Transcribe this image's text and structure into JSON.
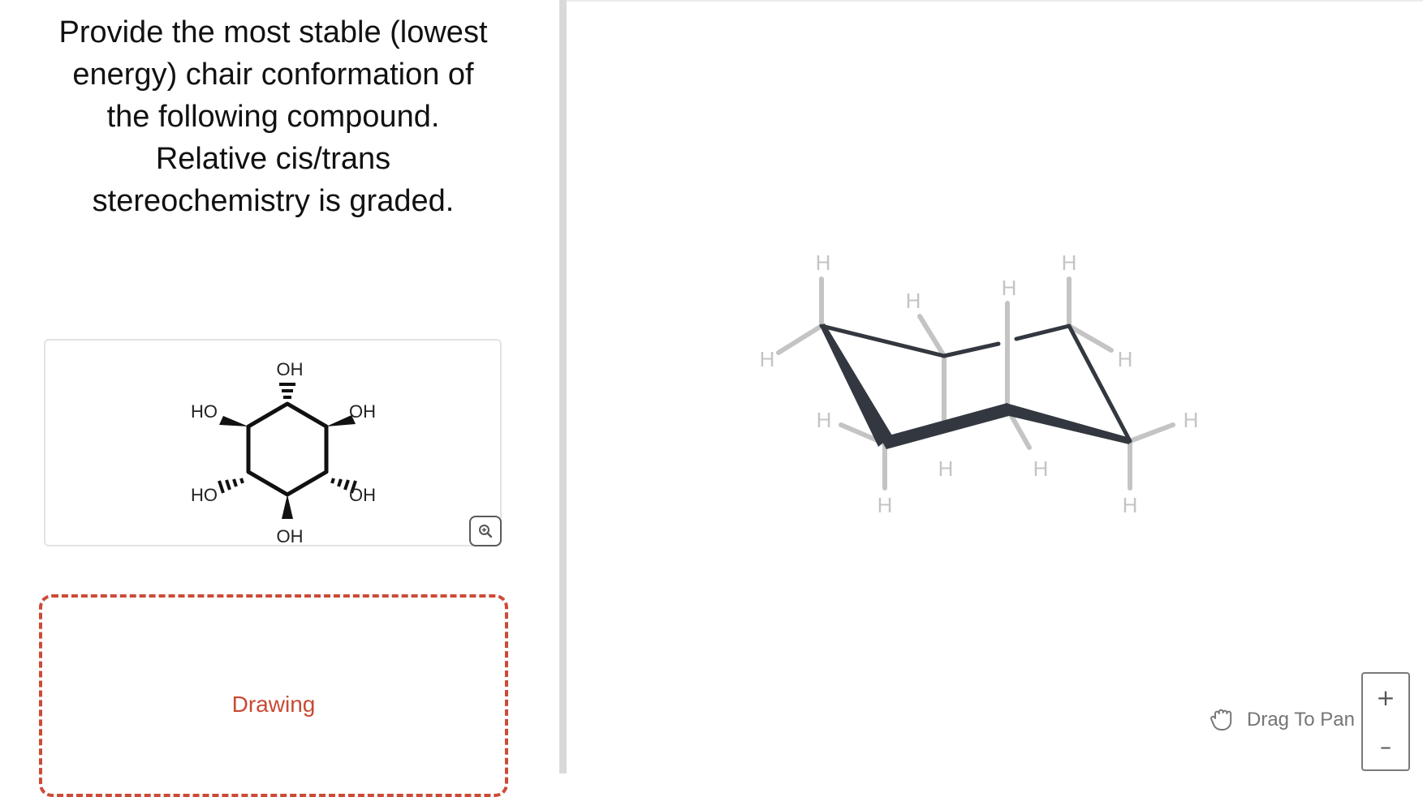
{
  "question": {
    "lines": [
      "Provide the most stable (lowest",
      "energy) chair conformation of",
      "the following compound.",
      "Relative cis/trans",
      "stereochemistry is graded."
    ]
  },
  "molecule": {
    "substituents": {
      "top": "OH",
      "upper_left": "HO",
      "upper_right": "OH",
      "lower_left": "HO",
      "lower_right": "OH",
      "bottom": "OH"
    },
    "zoom_icon": "zoom-in-icon"
  },
  "drawing": {
    "label": "Drawing"
  },
  "canvas": {
    "hydrogen_label": "H",
    "pan_label": "Drag To Pan",
    "pan_icon": "hand-icon",
    "zoom_in": "+",
    "zoom_out": "–"
  },
  "colors": {
    "accent": "#cc4b37",
    "bond": "#333840",
    "hydrogen": "#c4c4c4"
  }
}
